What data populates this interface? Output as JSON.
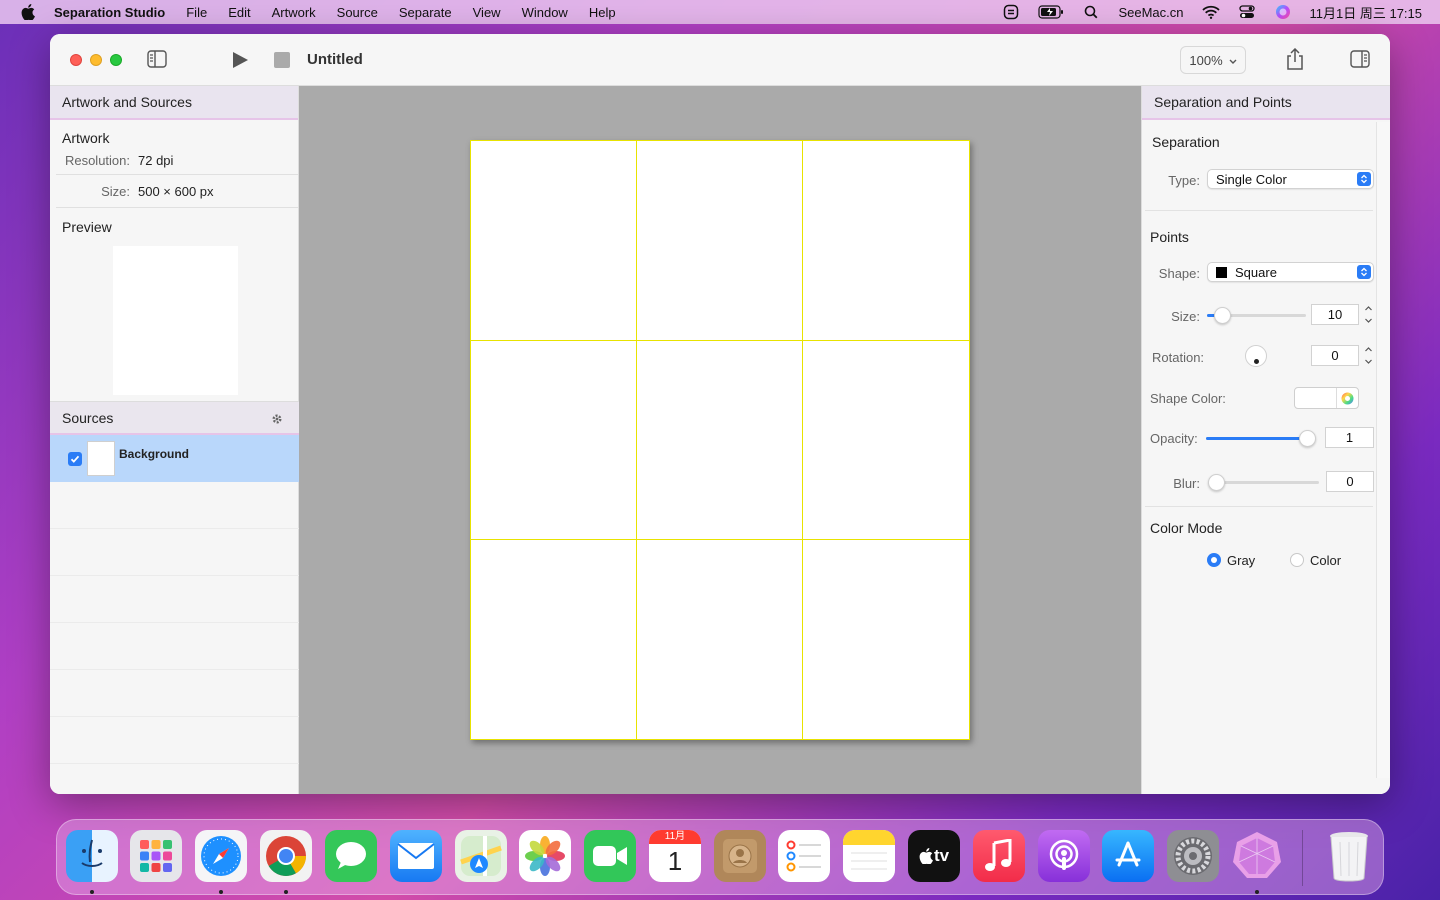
{
  "menubar": {
    "app_name": "Separation Studio",
    "items": [
      "File",
      "Edit",
      "Artwork",
      "Source",
      "Separate",
      "View",
      "Window",
      "Help"
    ],
    "right": {
      "user": "SeeMac.cn",
      "datetime": "11月1日 周三  17:15"
    }
  },
  "toolbar": {
    "doc_title": "Untitled",
    "zoom": "100%"
  },
  "left_panel": {
    "header": "Artwork and Sources",
    "artwork_title": "Artwork",
    "resolution_label": "Resolution:",
    "resolution_value": "72 dpi",
    "size_label": "Size:",
    "size_value": "500 × 600 px",
    "preview_title": "Preview",
    "sources_title": "Sources",
    "sources": [
      {
        "name": "Background",
        "checked": true
      }
    ]
  },
  "right_panel": {
    "header": "Separation and Points",
    "separation_title": "Separation",
    "type_label": "Type:",
    "type_value": "Single Color",
    "points_title": "Points",
    "shape_label": "Shape:",
    "shape_value": "Square",
    "size_label": "Size:",
    "size_value": "10",
    "rotation_label": "Rotation:",
    "rotation_value": "0",
    "shape_color_label": "Shape Color:",
    "opacity_label": "Opacity:",
    "opacity_value": "1",
    "blur_label": "Blur:",
    "blur_value": "0",
    "color_mode_title": "Color Mode",
    "mode_gray": "Gray",
    "mode_color": "Color",
    "selected_mode": "Gray"
  },
  "colors": {
    "accent": "#2a7cf6",
    "grid_lines": "#e8e300",
    "canvas_bg": "#aaaaaa"
  },
  "dock": {
    "apps": [
      "finder-icon",
      "launchpad-icon",
      "safari-icon",
      "chrome-icon",
      "messages-icon",
      "mail-icon",
      "maps-icon",
      "photos-icon",
      "facetime-icon",
      "calendar-icon",
      "contacts-icon",
      "reminders-icon",
      "notes-icon",
      "appletv-icon",
      "music-icon",
      "podcasts-icon",
      "appstore-icon",
      "system-preferences-icon",
      "separation-studio-icon",
      "trash-icon"
    ],
    "calendar_month": "11月",
    "calendar_day": "1",
    "tv_label": "tv"
  }
}
